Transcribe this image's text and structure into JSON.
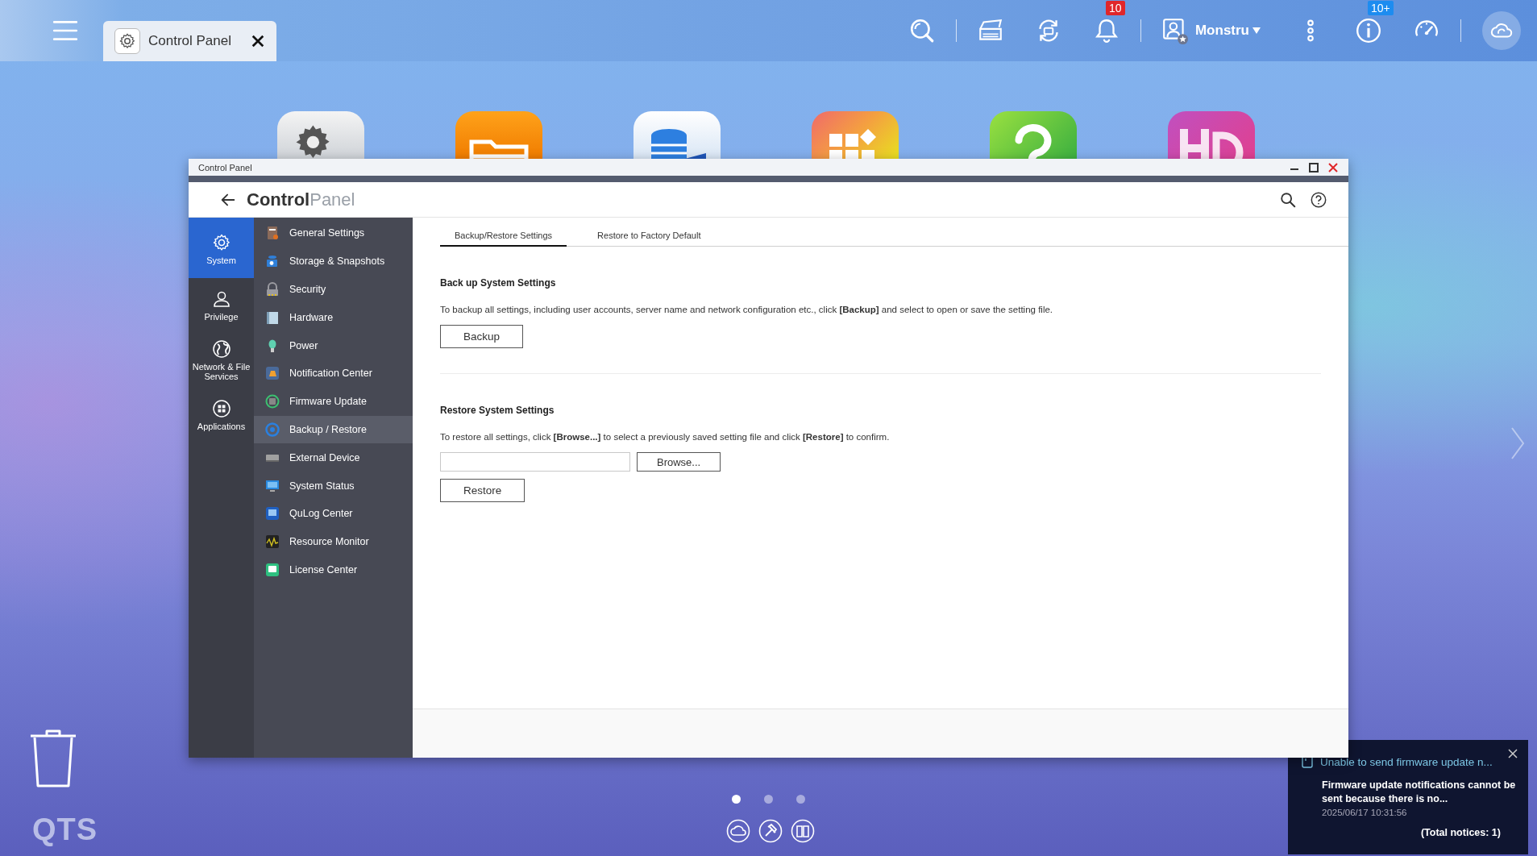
{
  "taskbar": {
    "tabs": [
      {
        "label": "Control Panel",
        "selected": true
      }
    ],
    "notifications_badge": "10",
    "user": "Monstru",
    "updates_badge": "10+"
  },
  "desktop": {
    "apps": [
      {
        "kind": "gear"
      },
      {
        "kind": "folder"
      },
      {
        "kind": "storage"
      },
      {
        "kind": "grid"
      },
      {
        "kind": "help"
      },
      {
        "kind": "hd"
      }
    ],
    "pager": [
      {
        "selected": true
      },
      {
        "selected": false
      },
      {
        "selected": false
      }
    ],
    "logo": "QTS"
  },
  "window": {
    "title": "Control Panel",
    "app_title": "**Control**Panel",
    "categories": [
      {
        "kind": "gear",
        "label": "System",
        "selected": true
      },
      {
        "kind": "person",
        "label": "Privilege",
        "selected": false
      },
      {
        "kind": "globe",
        "label": "Network & File Services",
        "selected": false
      },
      {
        "kind": "grid",
        "label": "Applications",
        "selected": false
      }
    ],
    "menu": [
      {
        "label": "General Settings",
        "color": "#8a6a5a",
        "selected": false
      },
      {
        "label": "Storage & Snapshots",
        "color": "#2f7fd8",
        "selected": false
      },
      {
        "label": "Security",
        "color": "#9a9aa0",
        "selected": false
      },
      {
        "label": "Hardware",
        "color": "#7fa0b8",
        "selected": false
      },
      {
        "label": "Power",
        "color": "#5fd0b0",
        "selected": false
      },
      {
        "label": "Notification Center",
        "color": "#f0a030",
        "selected": false
      },
      {
        "label": "Firmware Update",
        "color": "#3cc070",
        "selected": false
      },
      {
        "label": "Backup / Restore",
        "color": "#2a80e0",
        "selected": true
      },
      {
        "label": "External Device",
        "color": "#a0a0a0",
        "selected": false
      },
      {
        "label": "System Status",
        "color": "#2a8ae0",
        "selected": false
      },
      {
        "label": "QuLog Center",
        "color": "#1f5fc0",
        "selected": false
      },
      {
        "label": "Resource Monitor",
        "color": "#d0c020",
        "selected": false
      },
      {
        "label": "License Center",
        "color": "#2ec080",
        "selected": false
      }
    ],
    "tabs": [
      {
        "label": "Backup/Restore Settings",
        "selected": true
      },
      {
        "label": "Restore to Factory Default",
        "selected": false
      }
    ],
    "backup": {
      "heading": "Back up System Settings",
      "text": "To backup all settings, including user accounts, server name and network configuration etc., click **[Backup]** and select to open or save the setting file.",
      "button": "Backup"
    },
    "restore": {
      "heading": "Restore System Settings",
      "text": "To restore all settings, click **[Browse...]** to select a previously saved setting file and click **[Restore]** to confirm.",
      "browse_button": "Browse...",
      "button": "Restore"
    }
  },
  "notification": {
    "title": "Unable to send firmware update n...",
    "body": "Firmware update notifications cannot be sent because there is no...",
    "time": "2025/06/17 10:31:56",
    "total": "(Total notices: 1)"
  }
}
